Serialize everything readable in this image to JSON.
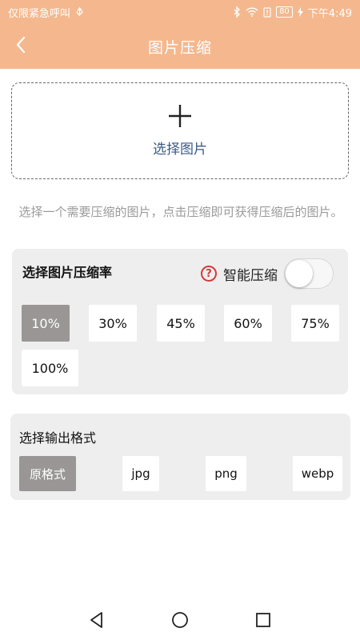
{
  "status_bar": {
    "carrier": "仅限紧急呼叫",
    "battery": "80",
    "time": "下午4:49"
  },
  "app_bar": {
    "title": "图片压缩",
    "icons": {
      "back": "chevron-left-icon"
    }
  },
  "picker": {
    "label": "选择图片",
    "icon": "plus-icon"
  },
  "hint": "选择一个需要压缩的图片，点击压缩即可获得压缩后的图片。",
  "compress": {
    "title": "选择图片压缩率",
    "smart_label": "智能压缩",
    "smart_enabled": false,
    "rates": [
      {
        "label": "10%",
        "selected": true
      },
      {
        "label": "30%",
        "selected": false
      },
      {
        "label": "45%",
        "selected": false
      },
      {
        "label": "60%",
        "selected": false
      },
      {
        "label": "75%",
        "selected": false
      },
      {
        "label": "100%",
        "selected": false
      }
    ]
  },
  "format": {
    "title": "选择输出格式",
    "options": [
      {
        "label": "原格式",
        "selected": true
      },
      {
        "label": "jpg",
        "selected": false
      },
      {
        "label": "png",
        "selected": false
      },
      {
        "label": "webp",
        "selected": false
      }
    ]
  },
  "colors": {
    "accent": "#f5b88e",
    "panel": "#eeeeee",
    "selected": "#9a9696",
    "help": "#d63a3a"
  }
}
